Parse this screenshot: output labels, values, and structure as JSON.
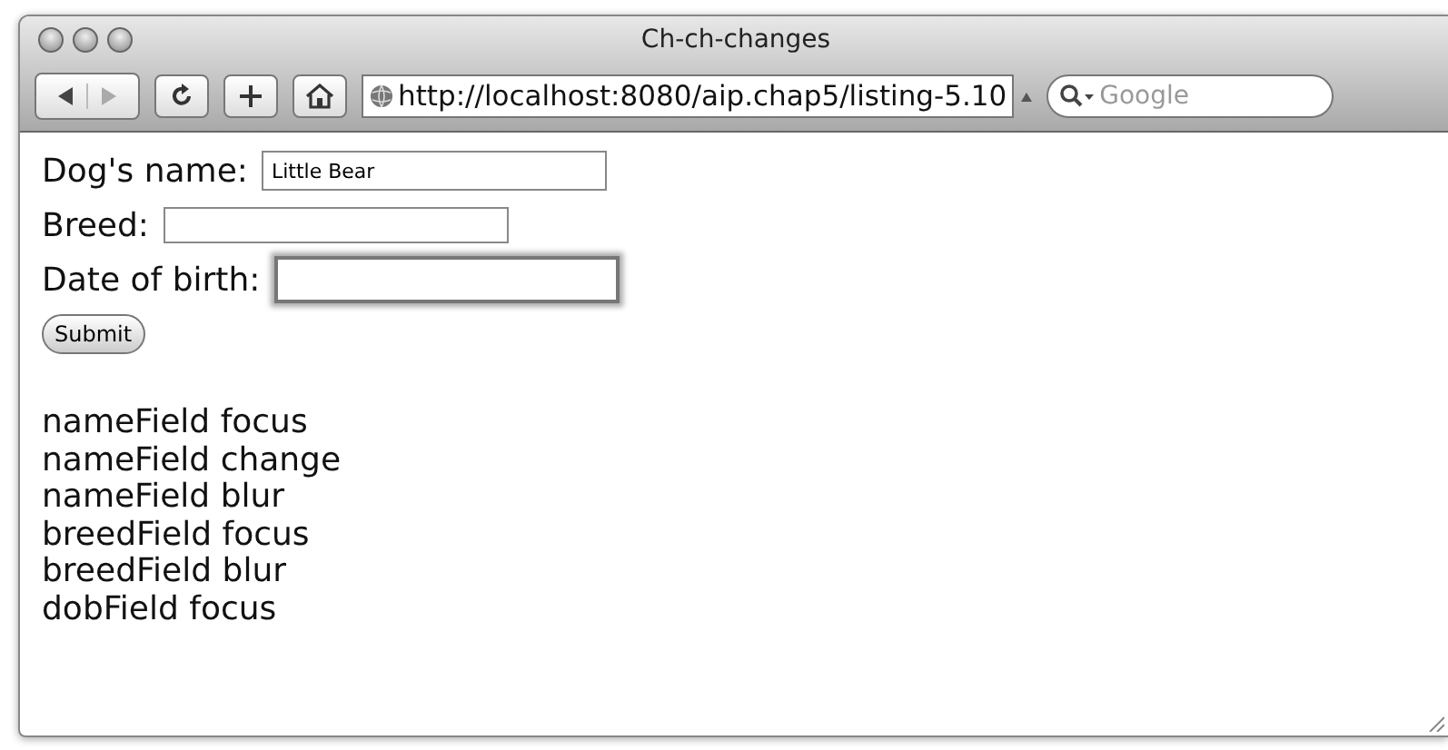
{
  "window": {
    "title": "Ch-ch-changes"
  },
  "toolbar": {
    "url": "http://localhost:8080/aip.chap5/listing-5.10",
    "search": {
      "placeholder": "Google"
    }
  },
  "form": {
    "fields": [
      {
        "label": "Dog's name:",
        "value": "Little Bear",
        "focused": false
      },
      {
        "label": "Breed:",
        "focused": false
      },
      {
        "label": "Date of birth:",
        "focused": true
      }
    ],
    "submit": "Submit"
  },
  "log": [
    "nameField focus",
    "nameField change",
    "nameField blur",
    "breedField focus",
    "breedField blur",
    "dobField focus"
  ]
}
